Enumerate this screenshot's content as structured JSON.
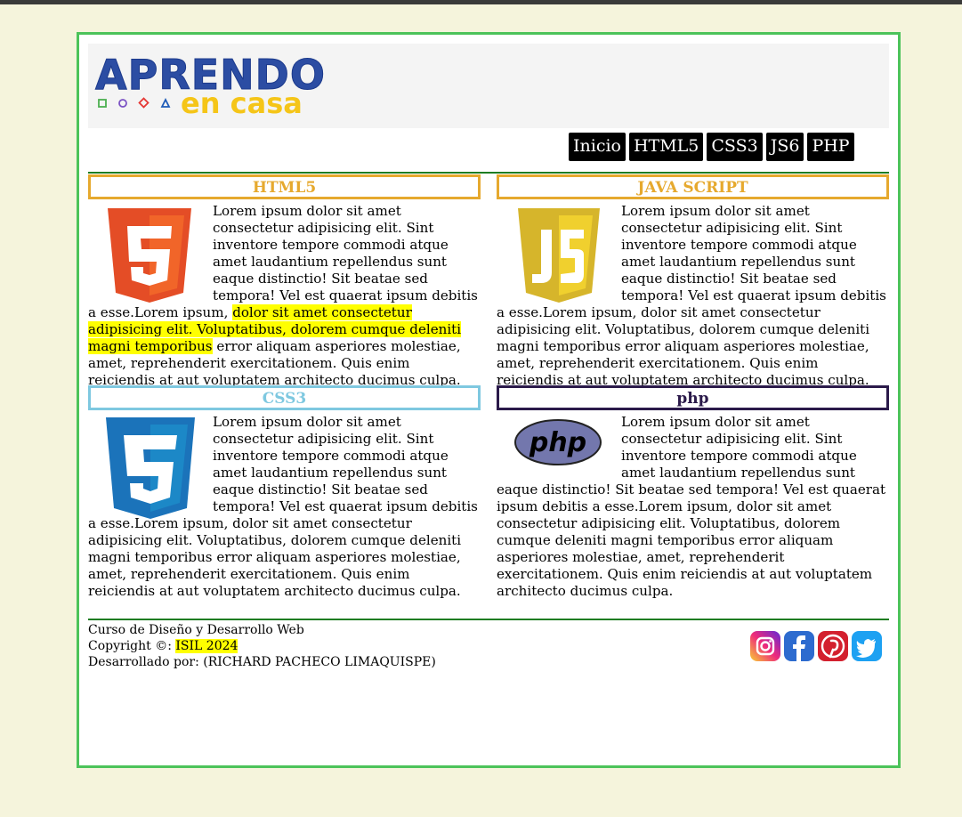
{
  "header": {
    "logo": {
      "word": "APRENDO",
      "sub": "en casa"
    }
  },
  "nav": {
    "items": [
      "Inicio",
      "HTML5",
      "CSS3",
      "JS6",
      "PHP"
    ]
  },
  "cards": [
    {
      "title": "HTML5",
      "title_color": "#e6a92e",
      "border_color": "#e6a92e",
      "logo": "html5-logo-icon",
      "text_before": "Lorem ipsum dolor sit amet consectetur adipisicing elit. Sint inventore tempore commodi atque amet laudantium repellendus sunt eaque distinctio! Sit beatae sed tempora! Vel est quaerat ipsum debitis a esse.Lorem ipsum, ",
      "highlighted": "dolor sit amet consectetur adipisicing elit. Voluptatibus, dolorem cumque deleniti magni temporibus",
      "text_after": " error aliquam asperiores molestiae, amet, reprehenderit exercitationem. Quis enim reiciendis at aut voluptatem architecto ducimus culpa."
    },
    {
      "title": "JAVA SCRIPT",
      "title_color": "#e6a92e",
      "border_color": "#e6a92e",
      "logo": "javascript-logo-icon",
      "text": "Lorem ipsum dolor sit amet consectetur adipisicing elit. Sint inventore tempore commodi atque amet laudantium repellendus sunt eaque distinctio! Sit beatae sed tempora! Vel est quaerat ipsum debitis a esse.Lorem ipsum, dolor sit amet consectetur adipisicing elit. Voluptatibus, dolorem cumque deleniti magni temporibus error aliquam asperiores molestiae, amet, reprehenderit exercitationem. Quis enim reiciendis at aut voluptatem architecto ducimus culpa."
    },
    {
      "title": "CSS3",
      "title_color": "#7ec8e0",
      "border_color": "#7ec8e0",
      "logo": "css3-logo-icon",
      "text": "Lorem ipsum dolor sit amet consectetur adipisicing elit. Sint inventore tempore commodi atque amet laudantium repellendus sunt eaque distinctio! Sit beatae sed tempora! Vel est quaerat ipsum debitis a esse.Lorem ipsum, dolor sit amet consectetur adipisicing elit. Voluptatibus, dolorem cumque deleniti magni temporibus error aliquam asperiores molestiae, amet, reprehenderit exercitationem. Quis enim reiciendis at aut voluptatem architecto ducimus culpa."
    },
    {
      "title": "php",
      "title_color": "#2b1a4a",
      "border_color": "#2b1a4a",
      "logo": "php-logo-icon",
      "text": "Lorem ipsum dolor sit amet consectetur adipisicing elit. Sint inventore tempore commodi atque amet laudantium repellendus sunt eaque distinctio! Sit beatae sed tempora! Vel est quaerat ipsum debitis a esse.Lorem ipsum, dolor sit amet consectetur adipisicing elit. Voluptatibus, dolorem cumque deleniti magni temporibus error aliquam asperiores molestiae, amet, reprehenderit exercitationem. Quis enim reiciendis at aut voluptatem architecto ducimus culpa."
    }
  ],
  "footer": {
    "line1": "Curso de Diseño y Desarrollo Web",
    "copyright_label": "Copyright ©: ",
    "copyright_value": "ISIL 2024",
    "line3": "Desarrollado por: (RICHARD PACHECO LIMAQUISPE)"
  },
  "social": [
    "instagram-icon",
    "facebook-icon",
    "pinterest-icon",
    "twitter-icon"
  ],
  "colors": {
    "page_border": "#4cc35a",
    "rule": "#1e7d22",
    "highlight": "#ffff00",
    "background": "#f5f4dc"
  }
}
